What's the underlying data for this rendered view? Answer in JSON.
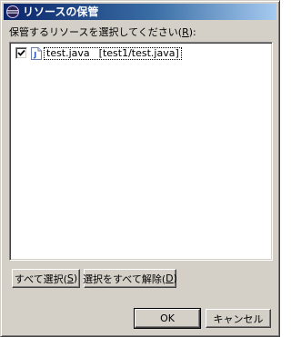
{
  "window": {
    "title": "リソースの保管"
  },
  "prompt": {
    "text": "保管するリソースを選択してください(",
    "hotkey": "R",
    "suffix": "):"
  },
  "list": {
    "items": [
      {
        "checked": true,
        "name": "test.java",
        "path": "[test1/test.java]",
        "icon": "java-file-icon"
      }
    ]
  },
  "buttons": {
    "select_all": {
      "label": "すべて選択(",
      "hotkey": "S",
      "suffix": ")"
    },
    "deselect_all": {
      "label": "選択をすべて解除(",
      "hotkey": "D",
      "suffix": ")"
    },
    "ok": {
      "label": "OK"
    },
    "cancel": {
      "label": "キャンセル"
    }
  },
  "colors": {
    "titlebar_start": "#0a246a",
    "titlebar_end": "#a6caf0",
    "face": "#d4d0c8"
  }
}
